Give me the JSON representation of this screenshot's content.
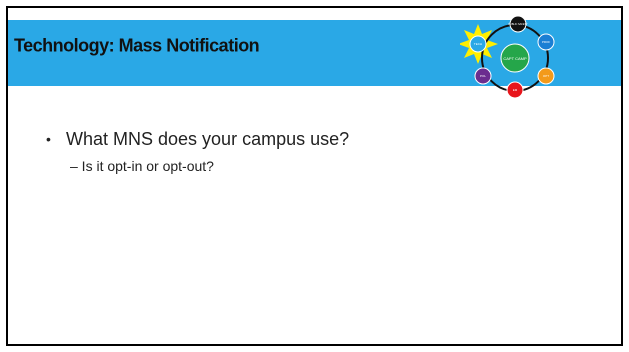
{
  "slide": {
    "title": "Technology: Mass Notification",
    "bullets": [
      {
        "text": "What MNS does your campus use?",
        "sub": "– Is it opt-in or opt-out?"
      }
    ]
  },
  "logo": {
    "nodes": [
      {
        "label": "PUBLIC SAFETY",
        "color": "#111111"
      },
      {
        "label": "PROF",
        "color": "#1a7fd4"
      },
      {
        "label": "OPT",
        "color": "#f39a1a"
      },
      {
        "label": "EM",
        "color": "#e8151b"
      },
      {
        "label": "POL",
        "color": "#6b2d8f"
      },
      {
        "label": "TECH",
        "color": "#2aa8e6"
      }
    ],
    "center": {
      "label": "CAPT CAMP",
      "color": "#25a64a"
    },
    "highlight_color": "#ffef00"
  }
}
